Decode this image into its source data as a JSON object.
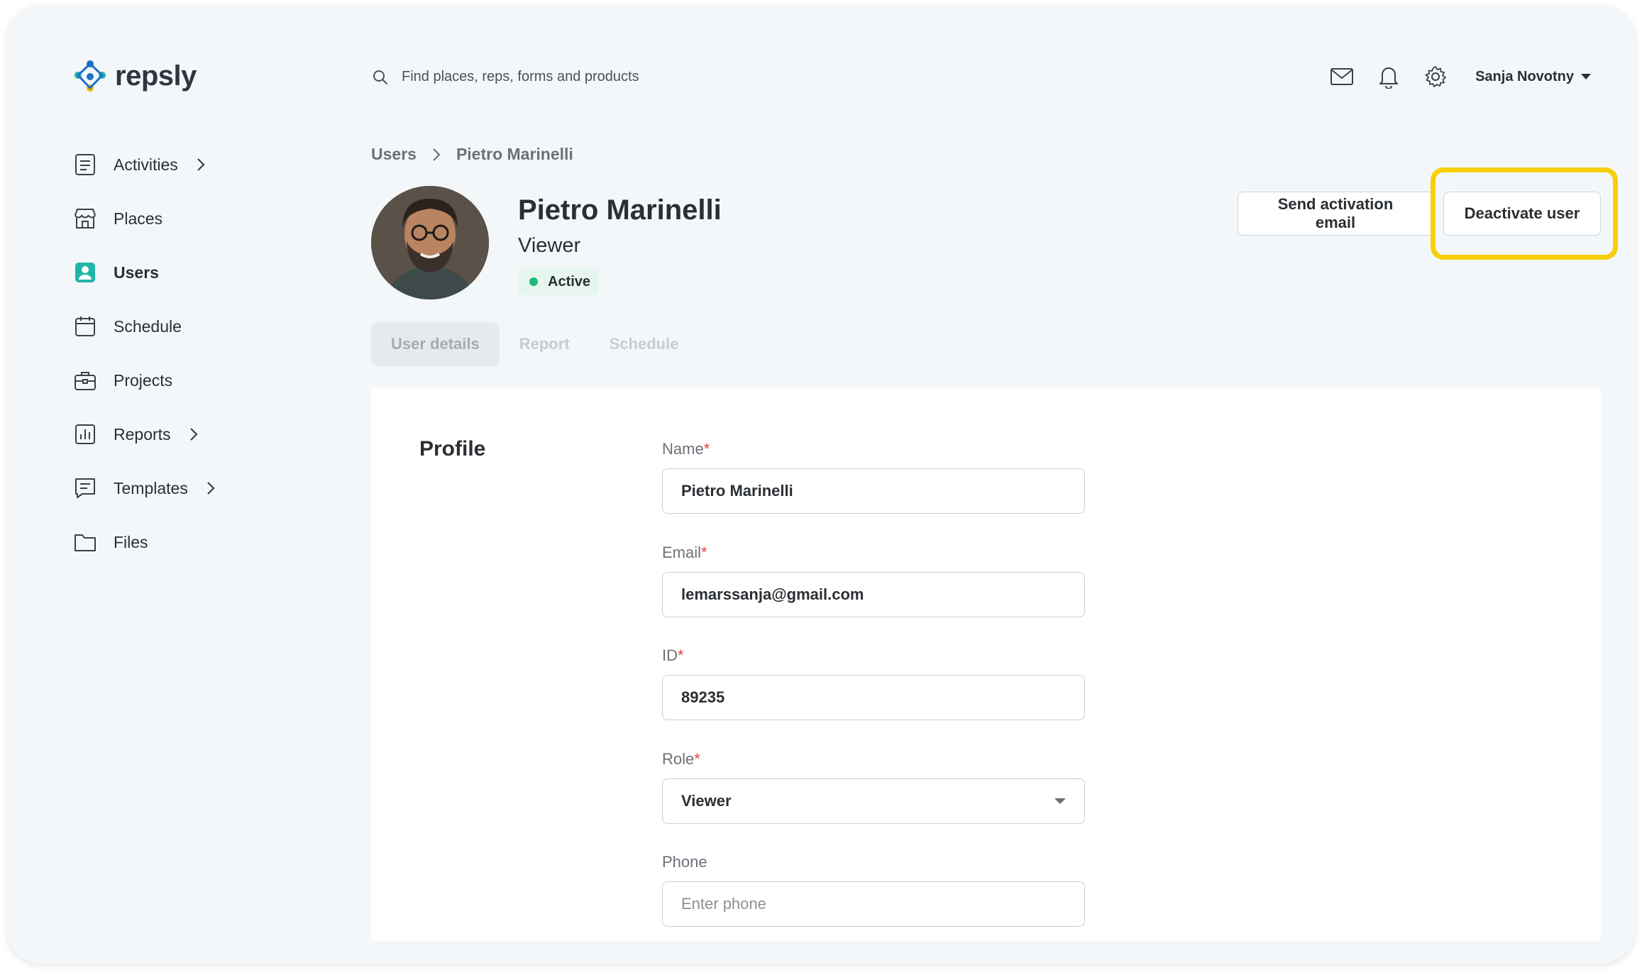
{
  "brand": {
    "name": "repsly"
  },
  "search": {
    "placeholder": "Find places, reps, forms and products"
  },
  "topbar": {
    "user_name": "Sanja Novotny"
  },
  "sidebar": {
    "items": [
      {
        "label": "Activities",
        "icon": "clipboard-icon"
      },
      {
        "label": "Places",
        "icon": "store-icon"
      },
      {
        "label": "Users",
        "icon": "user-icon"
      },
      {
        "label": "Schedule",
        "icon": "calendar-icon"
      },
      {
        "label": "Projects",
        "icon": "briefcase-icon"
      },
      {
        "label": "Reports",
        "icon": "bar-chart-icon"
      },
      {
        "label": "Templates",
        "icon": "template-icon"
      },
      {
        "label": "Files",
        "icon": "folder-icon"
      }
    ]
  },
  "breadcrumb": {
    "parent": "Users",
    "current": "Pietro Marinelli"
  },
  "profile": {
    "name": "Pietro Marinelli",
    "role": "Viewer",
    "status": "Active"
  },
  "actions": {
    "send_activation": "Send activation email",
    "deactivate": "Deactivate user"
  },
  "tabs": [
    {
      "label": "User details"
    },
    {
      "label": "Report"
    },
    {
      "label": "Schedule"
    }
  ],
  "form": {
    "section_title": "Profile",
    "name": {
      "label": "Name",
      "value": "Pietro Marinelli"
    },
    "email": {
      "label": "Email",
      "value": "lemarssanja@gmail.com"
    },
    "id": {
      "label": "ID",
      "value": "89235"
    },
    "role": {
      "label": "Role",
      "value": "Viewer"
    },
    "phone": {
      "label": "Phone",
      "placeholder": "Enter phone"
    },
    "required_mark": "*"
  },
  "colors": {
    "accent_teal": "#1fb5a8",
    "highlight_yellow": "#f7cf0b",
    "status_green": "#1fba78"
  }
}
